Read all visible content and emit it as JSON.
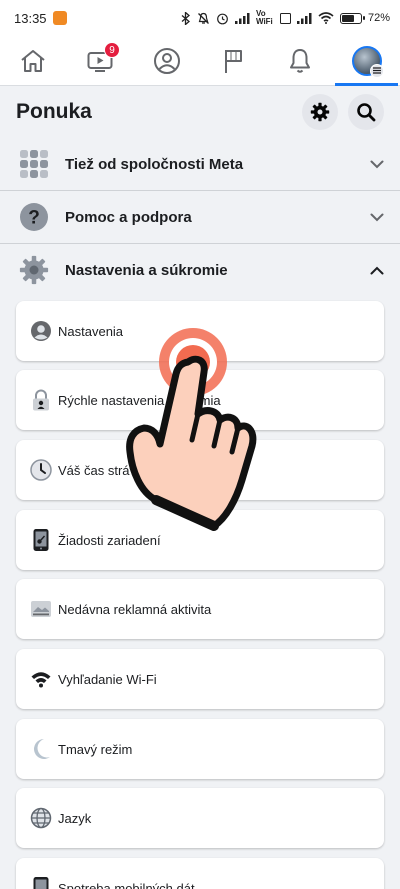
{
  "status_bar": {
    "time": "13:35",
    "network_label": "Vo WiFi",
    "battery_percent": "72",
    "battery_suffix": "%"
  },
  "tabs": [
    {
      "name": "home",
      "icon": "home-icon"
    },
    {
      "name": "watch",
      "icon": "video-icon",
      "badge": "9"
    },
    {
      "name": "profile",
      "icon": "profile-icon"
    },
    {
      "name": "pages",
      "icon": "flag-icon"
    },
    {
      "name": "notifications",
      "icon": "bell-icon"
    },
    {
      "name": "menu",
      "icon": "avatar-menu-icon",
      "active": true
    }
  ],
  "header": {
    "title": "Ponuka"
  },
  "sections": {
    "meta": {
      "label": "Tiež od spoločnosti Meta",
      "expanded": false
    },
    "help": {
      "label": "Pomoc a podpora",
      "expanded": false
    },
    "settings": {
      "label": "Nastavenia a súkromie",
      "expanded": true
    }
  },
  "settings_items": [
    {
      "label": "Nastavenia",
      "icon": "account-icon"
    },
    {
      "label": "Rýchle nastavenia súkromia",
      "icon": "privacy-lock-icon"
    },
    {
      "label": "Váš čas strávený na Facebooku",
      "icon": "clock-icon"
    },
    {
      "label": "Žiadosti zariadení",
      "icon": "device-icon"
    },
    {
      "label": "Nedávna reklamná aktivita",
      "icon": "ad-activity-icon"
    },
    {
      "label": "Vyhľadanie Wi-Fi",
      "icon": "wifi-icon"
    },
    {
      "label": "Tmavý režim",
      "icon": "moon-icon"
    },
    {
      "label": "Jazyk",
      "icon": "globe-icon"
    },
    {
      "label": "Spotreba mobilných dát",
      "icon": "phone-data-icon"
    }
  ],
  "colors": {
    "accent": "#1877f2",
    "background": "#f0f2f5",
    "badge": "#e41e3f",
    "tap_indicator": "#f26b50"
  }
}
